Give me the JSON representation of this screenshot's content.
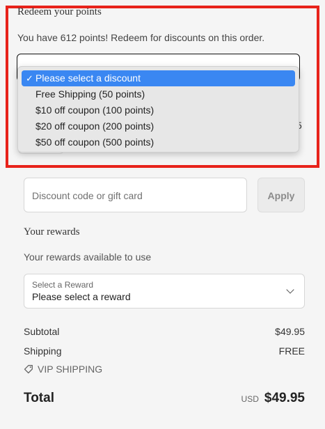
{
  "redeem": {
    "title": "Redeem your points",
    "description": "You have 612 points! Redeem for discounts on this order.",
    "options": [
      "Please select a discount",
      "Free Shipping (50 points)",
      "$10 off coupon (100 points)",
      "$20 off coupon (200 points)",
      "$50 off coupon (500 points)"
    ],
    "selected_index": 0,
    "check_glyph": "✓"
  },
  "hidden_fragment": "5",
  "discount": {
    "placeholder": "Discount code or gift card",
    "apply_label": "Apply"
  },
  "rewards": {
    "title": "Your rewards",
    "description": "Your rewards available to use",
    "select_caption": "Select a Reward",
    "select_value": "Please select a reward"
  },
  "summary": {
    "subtotal_label": "Subtotal",
    "subtotal_value": "$49.95",
    "shipping_label": "Shipping",
    "shipping_value": "FREE",
    "vip_label": "VIP SHIPPING",
    "total_label": "Total",
    "currency": "USD",
    "total_value": "$49.95"
  },
  "colors": {
    "highlight_border": "#e8231b",
    "selected_option": "#3a87f2"
  }
}
